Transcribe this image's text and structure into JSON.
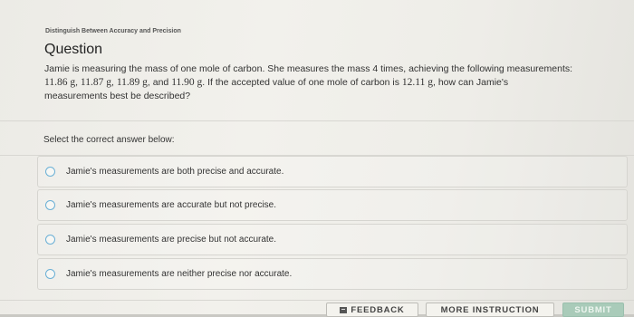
{
  "header": {
    "breadcrumb": "Distinguish Between Accuracy and Precision",
    "title": "Question"
  },
  "question": {
    "line1": "Jamie is measuring the mass of one mole of carbon. She measures the mass 4 times, achieving the following measurements:",
    "m1": "11.86 g",
    "m2": "11.87 g",
    "m3": "11.89 g",
    "m4": "11.90 g",
    "accepted_prefix": ". If the accepted value of one mole of carbon is ",
    "accepted_value": "12.11 g",
    "accepted_suffix": ", how can Jamie's",
    "line3": "measurements best be described?"
  },
  "prompt": "Select the correct answer below:",
  "options": [
    {
      "label": "Jamie's measurements are both precise and accurate."
    },
    {
      "label": "Jamie's measurements are accurate but not precise."
    },
    {
      "label": "Jamie's measurements are precise but not accurate."
    },
    {
      "label": "Jamie's measurements are neither precise nor accurate."
    }
  ],
  "footer": {
    "feedback_label": "FEEDBACK",
    "more_label": "MORE INSTRUCTION",
    "submit_label": "SUBMIT"
  },
  "colors": {
    "radio_border": "#6bb0d6",
    "submit_bg": "#a9cbb9"
  }
}
